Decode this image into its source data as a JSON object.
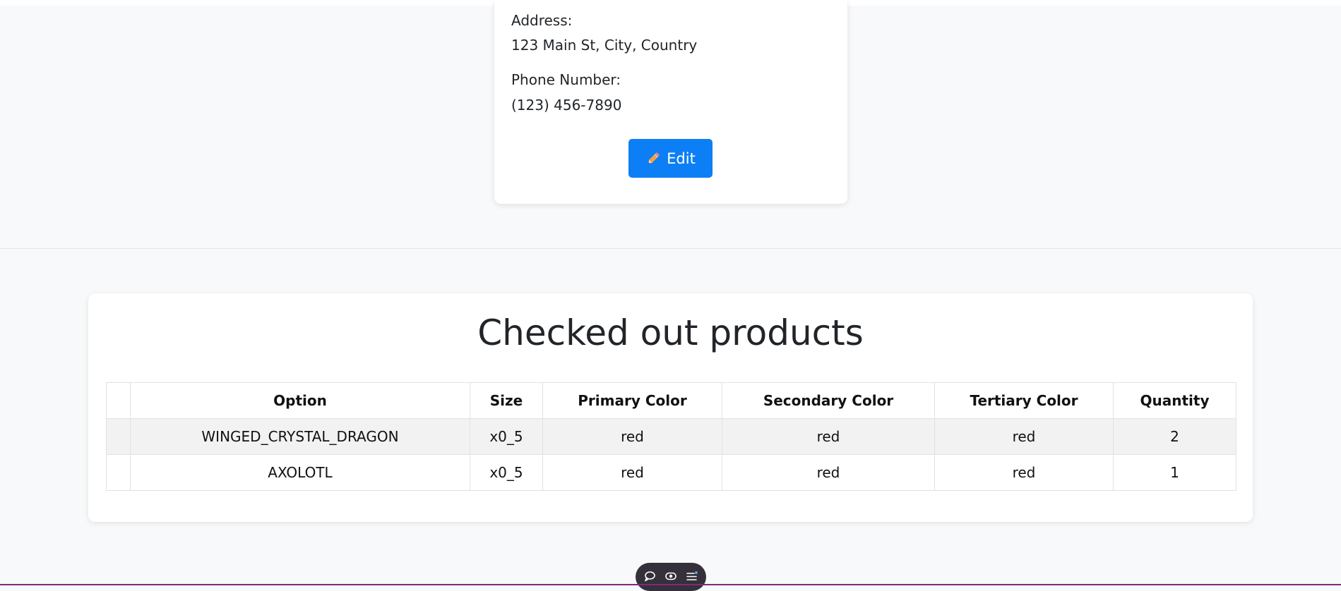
{
  "profile": {
    "address_label": "Address:",
    "address_value": "123 Main St, City, Country",
    "phone_label": "Phone Number:",
    "phone_value": "(123) 456-7890",
    "edit_label": "Edit",
    "edit_icon": "pencil-icon"
  },
  "products": {
    "title": "Checked out products",
    "columns": [
      "",
      "Option",
      "Size",
      "Primary Color",
      "Secondary Color",
      "Tertiary Color",
      "Quantity"
    ],
    "rows": [
      [
        "",
        "WINGED_CRYSTAL_DRAGON",
        "x0_5",
        "red",
        "red",
        "red",
        "2"
      ],
      [
        "",
        "AXOLOTL",
        "x0_5",
        "red",
        "red",
        "red",
        "1"
      ]
    ]
  },
  "toolbar": {
    "icons": [
      "comment-icon",
      "eye-icon",
      "menu-list-icon"
    ]
  },
  "colors": {
    "accent": "#0d7ff6",
    "page_background": "#f8f9fa",
    "card_background": "#ffffff",
    "toolbar_background": "#35303a",
    "bottom_line": "#7d2b7d"
  }
}
